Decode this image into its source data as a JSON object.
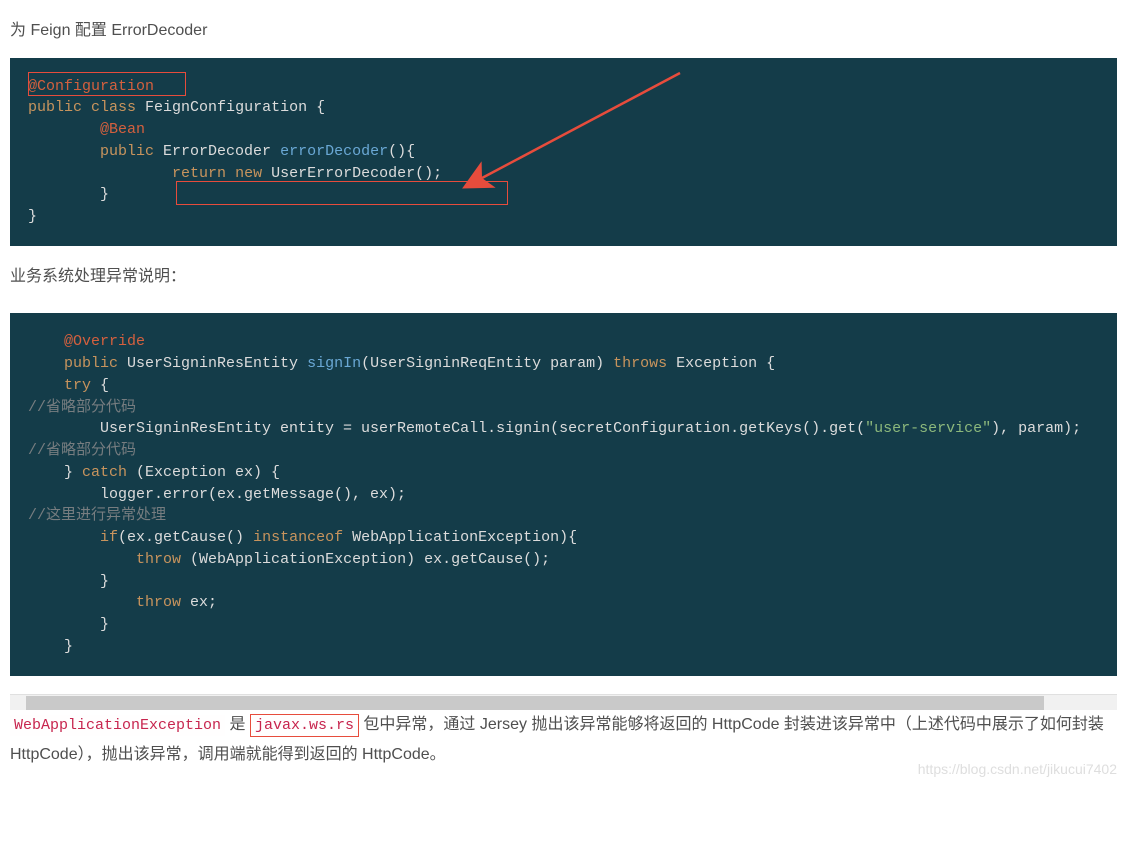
{
  "para1": "为 Feign 配置 ErrorDecoder",
  "code1": {
    "l1_anno": "@Configuration",
    "l2_kw1": "public",
    "l2_kw2": "class",
    "l2_rest": " FeignConfiguration {",
    "l3_anno": "@Bean",
    "l4_kw": "public",
    "l4_type": " ErrorDecoder ",
    "l4_fn": "errorDecoder",
    "l4_rest": "(){",
    "l5_kw1": "return",
    "l5_kw2": "new",
    "l5_rest": " UserErrorDecoder();",
    "l6": "        }",
    "l7": "}"
  },
  "para2": "业务系统处理异常说明：",
  "code2": {
    "l1_anno": "@Override",
    "l2_kw": "public",
    "l2_type": " UserSigninResEntity ",
    "l2_fn": "signIn",
    "l2_params": "(UserSigninReqEntity param) ",
    "l2_kw2": "throws",
    "l2_rest": " Exception {",
    "l3_kw": "try",
    "l3_rest": " {",
    "l4_cmt": "//省略部分代码",
    "l5_pre": "        UserSigninResEntity entity = userRemoteCall.signin(secretConfiguration.getKeys().get(",
    "l5_str": "\"user-service\"",
    "l5_post": "), param);",
    "l6_cmt": "//省略部分代码",
    "l7_pre": "    } ",
    "l7_kw": "catch",
    "l7_rest": " (Exception ex) {",
    "l8": "        logger.error(ex.getMessage(), ex);",
    "l9_cmt": "//这里进行异常处理",
    "l10_pre": "        ",
    "l10_kw": "if",
    "l10_mid": "(ex.getCause() ",
    "l10_kw2": "instanceof",
    "l10_rest": " WebApplicationException){",
    "l11_pre": "            ",
    "l11_kw": "throw",
    "l11_rest": " (WebApplicationException) ex.getCause();",
    "l12": "        }",
    "l13_pre": "            ",
    "l13_kw": "throw",
    "l13_rest": " ex;",
    "l14": "        }",
    "l15": "    }"
  },
  "explain": {
    "inlineCode1": "WebApplicationException",
    "mid1": " 是 ",
    "inlineCode2": "javax.ws.rs",
    "rest": " 包中异常，通过 Jersey 抛出该异常能够将返回的 HttpCode 封装进该异常中（上述代码中展示了如何封装 HttpCode），抛出该异常，调用端就能得到返回的 HttpCode。"
  },
  "watermark": "https://blog.csdn.net/jikucui7402"
}
